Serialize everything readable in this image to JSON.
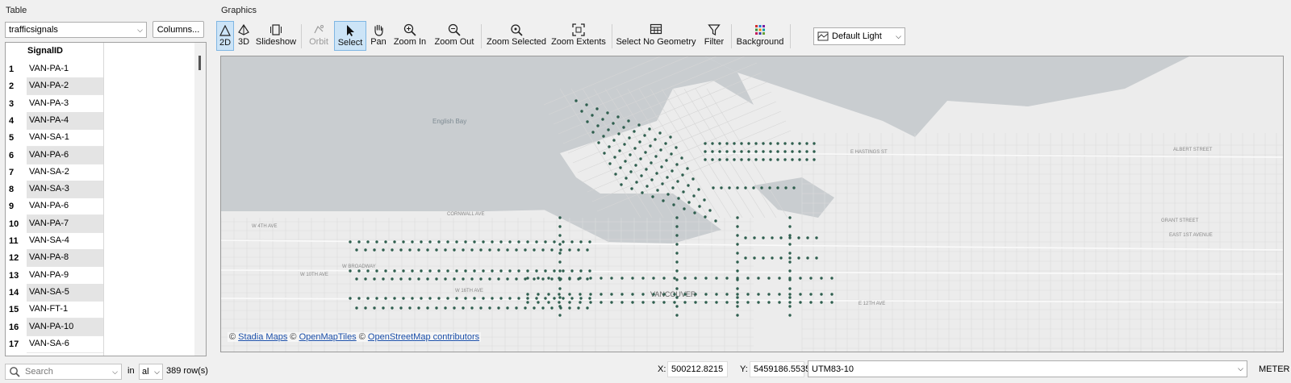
{
  "table": {
    "group_title": "Table",
    "layer": "trafficsignals",
    "columns_button": "Columns...",
    "column_header": "SignalID",
    "rows": [
      {
        "n": "1",
        "id": "VAN-PA-1"
      },
      {
        "n": "2",
        "id": "VAN-PA-2"
      },
      {
        "n": "3",
        "id": "VAN-PA-3"
      },
      {
        "n": "4",
        "id": "VAN-PA-4"
      },
      {
        "n": "5",
        "id": "VAN-SA-1"
      },
      {
        "n": "6",
        "id": "VAN-PA-6"
      },
      {
        "n": "7",
        "id": "VAN-SA-2"
      },
      {
        "n": "8",
        "id": "VAN-SA-3"
      },
      {
        "n": "9",
        "id": "VAN-PA-6"
      },
      {
        "n": "10",
        "id": "VAN-PA-7"
      },
      {
        "n": "11",
        "id": "VAN-SA-4"
      },
      {
        "n": "12",
        "id": "VAN-PA-8"
      },
      {
        "n": "13",
        "id": "VAN-PA-9"
      },
      {
        "n": "14",
        "id": "VAN-SA-5"
      },
      {
        "n": "15",
        "id": "VAN-FT-1"
      },
      {
        "n": "16",
        "id": "VAN-PA-10"
      },
      {
        "n": "17",
        "id": "VAN-SA-6"
      }
    ],
    "search_placeholder": "Search",
    "in_label": "in",
    "in_value": "al",
    "row_count": "389 row(s)"
  },
  "graphics": {
    "group_title": "Graphics",
    "toolbar": {
      "b2d": "2D",
      "b3d": "3D",
      "slideshow": "Slideshow",
      "orbit": "Orbit",
      "select": "Select",
      "pan": "Pan",
      "zoom_in": "Zoom In",
      "zoom_out": "Zoom Out",
      "zoom_selected": "Zoom Selected",
      "zoom_extents": "Zoom Extents",
      "select_no_geometry": "Select No Geometry",
      "filter": "Filter",
      "background": "Background"
    },
    "basemap": "Default Light",
    "map_labels": {
      "english_bay": "English Bay",
      "vancouver": "VANCOUVER",
      "hastings": "E HASTINGS ST",
      "w4th": "W 4TH AVE",
      "broadway": "W BROADWAY",
      "w10th": "W 10TH AVE",
      "w16th": "W 16TH AVE",
      "e12th": "E 12TH AVE",
      "e1st": "EAST 1ST AVENUE",
      "grant": "GRANT STREET",
      "albert": "ALBERT STREET",
      "cornwall": "CORNWALL AVE"
    },
    "attribution": {
      "sep1": "©",
      "stadia": "Stadia Maps",
      "sep2": "©",
      "omt": "OpenMapTiles",
      "sep3": "©",
      "osm": "OpenStreetMap contributors"
    },
    "colors": {
      "water": "#c9cdd0",
      "land": "#ececec",
      "signal": "#2e5e4e"
    }
  },
  "status": {
    "x_label": "X:",
    "x_value": "500212.8215",
    "y_label": "Y:",
    "y_value": "5459186.5535",
    "crs": "UTM83-10",
    "units": "METER"
  }
}
